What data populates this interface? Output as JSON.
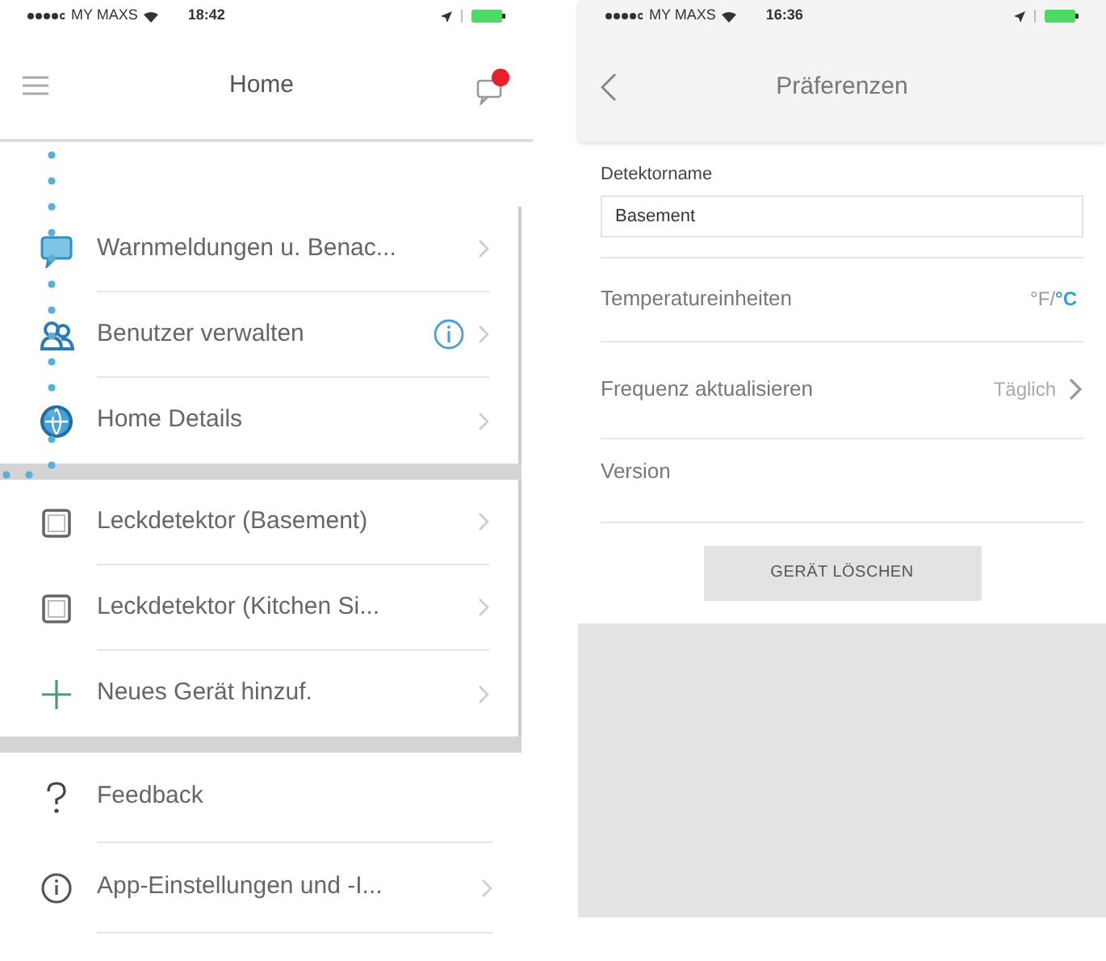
{
  "screens": [
    {
      "status_bar": {
        "carrier": "MY MAXS",
        "time": "18:42"
      },
      "nav": {
        "title": "Home",
        "notification_badge": true
      },
      "sections": [
        [
          {
            "kind": "chat",
            "label": "Warnmeldungen u. Benac...",
            "info_badge": false,
            "chevron": true
          },
          {
            "kind": "users",
            "label": "Benutzer verwalten",
            "info_badge": true,
            "chevron": true
          },
          {
            "kind": "globe",
            "label": "Home Details",
            "info_badge": false,
            "chevron": true
          }
        ],
        [
          {
            "kind": "device",
            "label": "Leckdetektor (Basement)",
            "info_badge": false,
            "chevron": true
          },
          {
            "kind": "device",
            "label": "Leckdetektor (Kitchen Si...",
            "info_badge": false,
            "chevron": true
          },
          {
            "kind": "add",
            "label": "Neues Gerät hinzuf.",
            "info_badge": false,
            "chevron": true
          }
        ],
        [
          {
            "kind": "help",
            "label": "Feedback",
            "info_badge": false,
            "chevron": false
          },
          {
            "kind": "info",
            "label": "App-Einstellungen und -I...",
            "info_badge": false,
            "chevron": true
          }
        ]
      ]
    },
    {
      "status_bar": {
        "carrier": "MY MAXS",
        "time": "16:36"
      },
      "nav": {
        "title": "Präferenzen",
        "back": true
      },
      "name_field": {
        "label": "Detektorname",
        "value": "Basement"
      },
      "temperature": {
        "label": "Temperatureinheiten",
        "separator": "/",
        "units": [
          {
            "label": "°F",
            "selected": false
          },
          {
            "label": "°C",
            "selected": true
          }
        ]
      },
      "frequency": {
        "label": "Frequenz aktualisieren",
        "value": "Täglich"
      },
      "version": {
        "label": "Version"
      },
      "delete_button": {
        "label": "GERÄT LÖSCHEN"
      }
    }
  ]
}
